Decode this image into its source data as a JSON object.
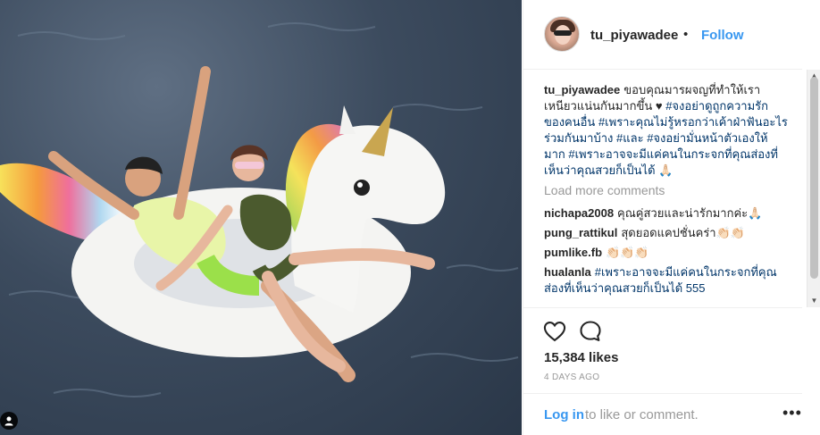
{
  "post": {
    "username": "tu_piyawadee",
    "separator": "•",
    "follow_label": "Follow"
  },
  "caption": {
    "username": "tu_piyawadee",
    "text_1": "ขอบคุณมารผจญที่ทำให้เราเหนียวแน่นกันมากขึ้น ♥ ",
    "tag_1": "#จงอย่าดูถูกความรักของคนอื่น",
    "text_2": " ",
    "tag_2": "#เพราะคุณไม่รู้หรอกว่าเค้าฝ่าฟันอะไรร่วมกันมาบ้าง",
    "text_3": " ",
    "tag_3": "#และ",
    "text_4": " ",
    "tag_4": "#จงอย่ามั่นหน้าตัวเองให้มาก",
    "text_5": " ",
    "tag_5": "#เพราะอาจจะมีแค่คนในกระจกที่คุณส่องที่เห็นว่าคุณสวยก็เป็นได้",
    "text_6": " 🙏🏻"
  },
  "load_more": "Load more comments",
  "comments": [
    {
      "username": "nichapa2008",
      "text": "คุณคู่สวยและน่ารักมากค่ะ🙏🏻"
    },
    {
      "username": "pung_rattikul",
      "text": "สุดยอดแคปชั่นคร่า👏🏻👏🏻"
    },
    {
      "username": "pumlike.fb",
      "text": "👏🏻👏🏻👏🏻"
    },
    {
      "username": "hualanla",
      "text": "#เพราะอาจจะมีแค่คนในกระจกที่คุณส่องที่เห็นว่าคุณสวยก็เป็นได้ 555"
    }
  ],
  "likes": "15,384 likes",
  "time_ago": "4 DAYS AGO",
  "footer": {
    "login": "Log in",
    "login_rest": "to like or comment.",
    "more": "•••"
  },
  "icons": {
    "like": "heart-icon",
    "comment": "comment-bubble-icon",
    "tag": "person-tag-icon",
    "more": "more-options-icon"
  },
  "colors": {
    "link": "#3897f0",
    "hashtag": "#003569",
    "muted": "#999999",
    "text": "#262626"
  }
}
